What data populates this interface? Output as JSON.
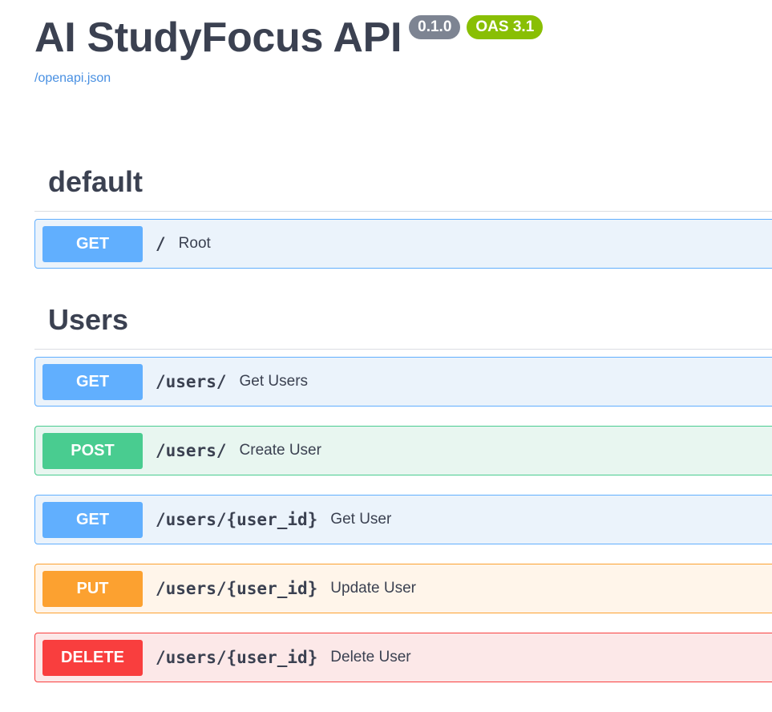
{
  "info": {
    "title": "AI StudyFocus API",
    "version_badge": "0.1.0",
    "oas_badge": "OAS 3.1",
    "spec_link": "/openapi.json"
  },
  "colors": {
    "get": "#61affe",
    "post": "#49cc90",
    "put": "#fca130",
    "delete": "#f93e3e",
    "version_badge": "#7d8492",
    "oas_badge": "#89bf04",
    "link": "#4990e2"
  },
  "tags": [
    {
      "name": "default",
      "operations": [
        {
          "method": "GET",
          "path": "/",
          "summary": "Root"
        }
      ]
    },
    {
      "name": "Users",
      "operations": [
        {
          "method": "GET",
          "path": "/users/",
          "summary": "Get Users"
        },
        {
          "method": "POST",
          "path": "/users/",
          "summary": "Create User"
        },
        {
          "method": "GET",
          "path": "/users/{user_id}",
          "summary": "Get User"
        },
        {
          "method": "PUT",
          "path": "/users/{user_id}",
          "summary": "Update User"
        },
        {
          "method": "DELETE",
          "path": "/users/{user_id}",
          "summary": "Delete User"
        }
      ]
    }
  ]
}
